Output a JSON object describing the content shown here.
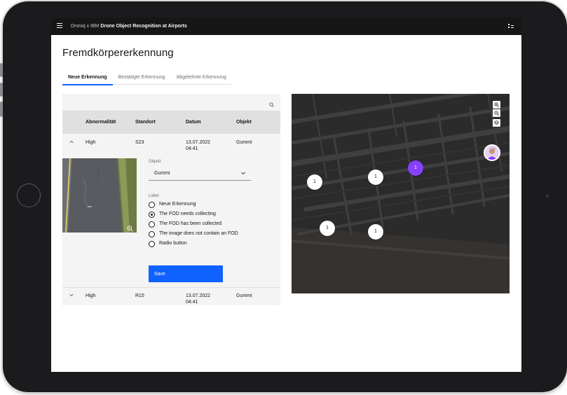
{
  "header": {
    "brand_prefix": "Droniq x IBM",
    "app_name": "Drone Object Recognition at Airports"
  },
  "page": {
    "title": "Fremdkörpererkennung"
  },
  "tabs": [
    {
      "label": "Neue Erkennung",
      "active": true
    },
    {
      "label": "Bestätigte Erkennung",
      "active": false
    },
    {
      "label": "Abgelehnte Erkennung",
      "active": false
    }
  ],
  "table": {
    "columns": [
      "Abnormalität",
      "Standort",
      "Datum",
      "Objekt"
    ],
    "rows": [
      {
        "abnormality": "High",
        "location": "S23",
        "date": "13.07.2022",
        "time": "04:41",
        "object": "Gummi",
        "expanded": true
      },
      {
        "abnormality": "High",
        "location": "R15",
        "date": "13.07.2022",
        "time": "04:41",
        "object": "Gummi",
        "expanded": false
      }
    ]
  },
  "detail": {
    "object_label": "Objekt",
    "object_value": "Gummi",
    "label_title": "Label",
    "radio_options": [
      "Neue Erkennung",
      "The FOD needs collecting",
      "The FOD has been collected",
      "The image does not contain an FOD",
      "Radio button"
    ],
    "selected_index": 1,
    "save_label": "Save"
  },
  "map": {
    "markers": [
      {
        "label": "1",
        "selected": false
      },
      {
        "label": "1",
        "selected": false
      },
      {
        "label": "1",
        "selected": true
      },
      {
        "label": "1",
        "selected": false
      },
      {
        "label": "1",
        "selected": false
      }
    ]
  },
  "colors": {
    "accent": "#0f62fe",
    "marker_selected": "#8a3ffc",
    "topbar": "#161616",
    "map_bg": "#2a2a2a"
  }
}
